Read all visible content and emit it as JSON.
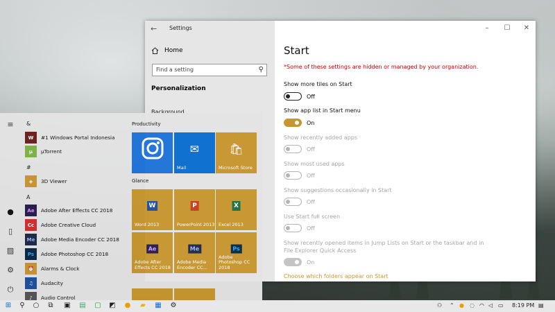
{
  "settings": {
    "title": "Settings",
    "back_glyph": "←",
    "minimize_glyph": "–",
    "maximize_glyph": "☐",
    "close_glyph": "✕",
    "home_label": "Home",
    "search_placeholder": "Find a setting",
    "section_title": "Personalization",
    "partial_item": "Background",
    "page_title": "Start",
    "warning": "*Some of these settings are hidden or managed by your organization.",
    "options": [
      {
        "label": "Show more tiles on Start",
        "state": "Off",
        "on": false,
        "disabled": false
      },
      {
        "label": "Show app list in Start menu",
        "state": "On",
        "on": true,
        "disabled": false
      },
      {
        "label": "Show recently added apps",
        "state": "Off",
        "on": false,
        "disabled": true
      },
      {
        "label": "Show most used apps",
        "state": "Off",
        "on": false,
        "disabled": true
      },
      {
        "label": "Show suggestions occasionally in Start",
        "state": "Off",
        "on": false,
        "disabled": true
      },
      {
        "label": "Use Start full screen",
        "state": "Off",
        "on": false,
        "disabled": true
      },
      {
        "label_line1": "Show recently opened items in Jump Lists on Start or the taskbar and in",
        "label_line2": "File Explorer Quick Access",
        "state": "On",
        "on": true,
        "disabled": true
      }
    ],
    "folders_link": "Choose which folders appear on Start",
    "accent_color": "#c8962f"
  },
  "start_menu": {
    "groups": {
      "amp": "&",
      "hash": "#",
      "a": "A"
    },
    "apps": [
      {
        "name": "#1 Windows Portal Indonesia",
        "icon": "portal-icon",
        "color": "#6b1d1d",
        "glyph": "W"
      },
      {
        "name": "µTorrent",
        "icon": "utorrent-icon",
        "color": "#7cb342",
        "glyph": "µ"
      },
      {
        "name": "3D Viewer",
        "icon": "3d-viewer-icon",
        "color": "#c8962f",
        "glyph": "◈"
      },
      {
        "name": "Adobe After Effects CC 2018",
        "icon": "after-effects-icon",
        "color": "#2a1b4d",
        "glyph": "Ae"
      },
      {
        "name": "Adobe Creative Cloud",
        "icon": "creative-cloud-icon",
        "color": "#d32f2f",
        "glyph": "Cc"
      },
      {
        "name": "Adobe Media Encoder CC 2018",
        "icon": "media-encoder-icon",
        "color": "#1f2a44",
        "glyph": "Me"
      },
      {
        "name": "Adobe Photoshop CC 2018",
        "icon": "photoshop-icon",
        "color": "#0b2a44",
        "glyph": "Ps"
      },
      {
        "name": "Alarms & Clock",
        "icon": "alarm-clock-icon",
        "color": "#c8962f",
        "glyph": "⏰"
      },
      {
        "name": "Audacity",
        "icon": "audacity-icon",
        "color": "#1f4fa0",
        "glyph": "♫"
      },
      {
        "name": "Audio Control",
        "icon": "audio-control-icon",
        "color": "#555555",
        "glyph": "♪"
      }
    ],
    "productivity_header": "Productivity",
    "glance_header": "Glance",
    "tiles": {
      "instagram": "",
      "mail": "Mail",
      "store": "Microsoft Store",
      "word": "Word 2013",
      "powerpoint": "PowerPoint 2013",
      "excel": "Excel 2013",
      "ae": "Adobe After Effects CC 2018",
      "me": "Adobe Media Encoder CC...",
      "ps": "Adobe Photoshop CC 2018"
    }
  },
  "taskbar": {
    "time": "8:19 PM"
  }
}
